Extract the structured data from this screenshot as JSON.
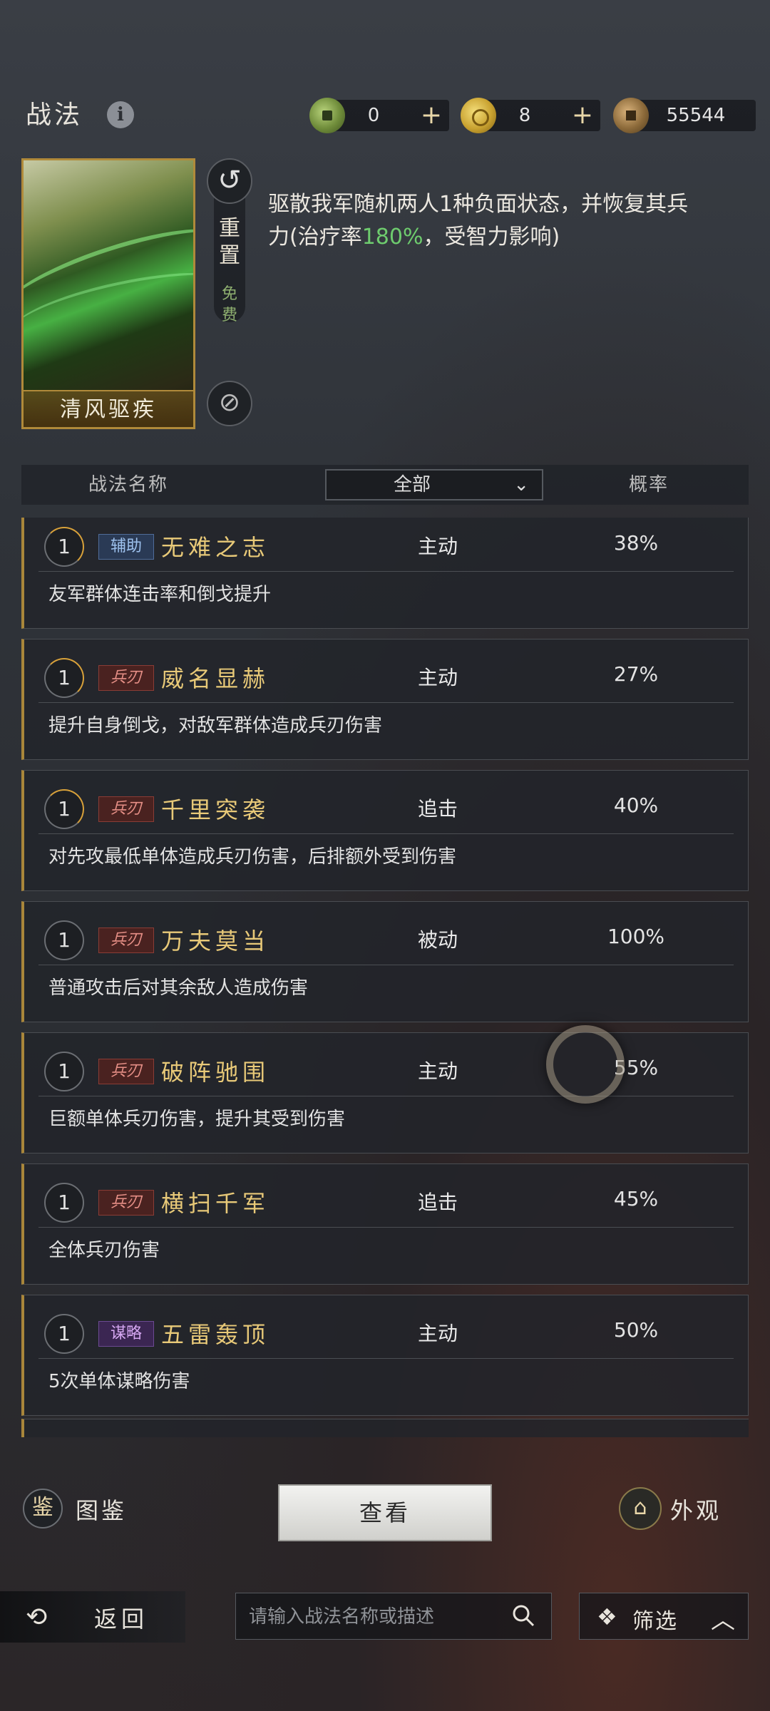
{
  "header": {
    "title": "战法",
    "info_icon": "info-icon",
    "currencies": [
      {
        "icon": "jade-coin-icon",
        "value": "0",
        "has_plus": true
      },
      {
        "icon": "gold-coin-icon",
        "value": "8",
        "has_plus": true
      },
      {
        "icon": "copper-coin-icon",
        "value": "55544",
        "has_plus": false
      }
    ],
    "plus": "+"
  },
  "preview": {
    "card_name": "清风驱疾",
    "reset_label": "重置",
    "free_label": "免费",
    "desc_part1": "驱散我军随机两人1种负面状态，并恢复其兵力(治疗率",
    "desc_highlight": "180%",
    "desc_part2": "，受智力影响)",
    "highlight_color": "#6ecc6e"
  },
  "table": {
    "col_name": "战法名称",
    "filter_value": "全部",
    "col_prob": "概率"
  },
  "skills": [
    {
      "level": "1",
      "tag": "辅助",
      "tag_class": "fuzhu",
      "name": "无难之志",
      "type": "主动",
      "prob": "38%",
      "desc": "友军群体连击率和倒戈提升"
    },
    {
      "level": "1",
      "tag": "兵刃",
      "tag_class": "bingren",
      "name": "威名显赫",
      "type": "主动",
      "prob": "27%",
      "desc": "提升自身倒戈，对敌军群体造成兵刃伤害"
    },
    {
      "level": "1",
      "tag": "兵刃",
      "tag_class": "bingren",
      "name": "千里突袭",
      "type": "追击",
      "prob": "40%",
      "desc": "对先攻最低单体造成兵刃伤害，后排额外受到伤害"
    },
    {
      "level": "1",
      "tag": "兵刃",
      "tag_class": "bingren",
      "name": "万夫莫当",
      "type": "被动",
      "prob": "100%",
      "desc": "普通攻击后对其余敌人造成伤害"
    },
    {
      "level": "1",
      "tag": "兵刃",
      "tag_class": "bingren",
      "name": "破阵驰围",
      "type": "主动",
      "prob": "55%",
      "desc": "巨额单体兵刃伤害，提升其受到伤害"
    },
    {
      "level": "1",
      "tag": "兵刃",
      "tag_class": "bingren",
      "name": "横扫千军",
      "type": "追击",
      "prob": "45%",
      "desc": "全体兵刃伤害"
    },
    {
      "level": "1",
      "tag": "谋略",
      "tag_class": "moulue",
      "name": "五雷轰顶",
      "type": "主动",
      "prob": "50%",
      "desc": "5次单体谋略伤害"
    }
  ],
  "actions": {
    "codex_icon_glyph": "鉴",
    "codex_label": "图鉴",
    "view_label": "查看",
    "appearance_label": "外观"
  },
  "bottom": {
    "back_label": "返回",
    "search_placeholder": "请输入战法名称或描述",
    "filter_label": "筛选"
  }
}
